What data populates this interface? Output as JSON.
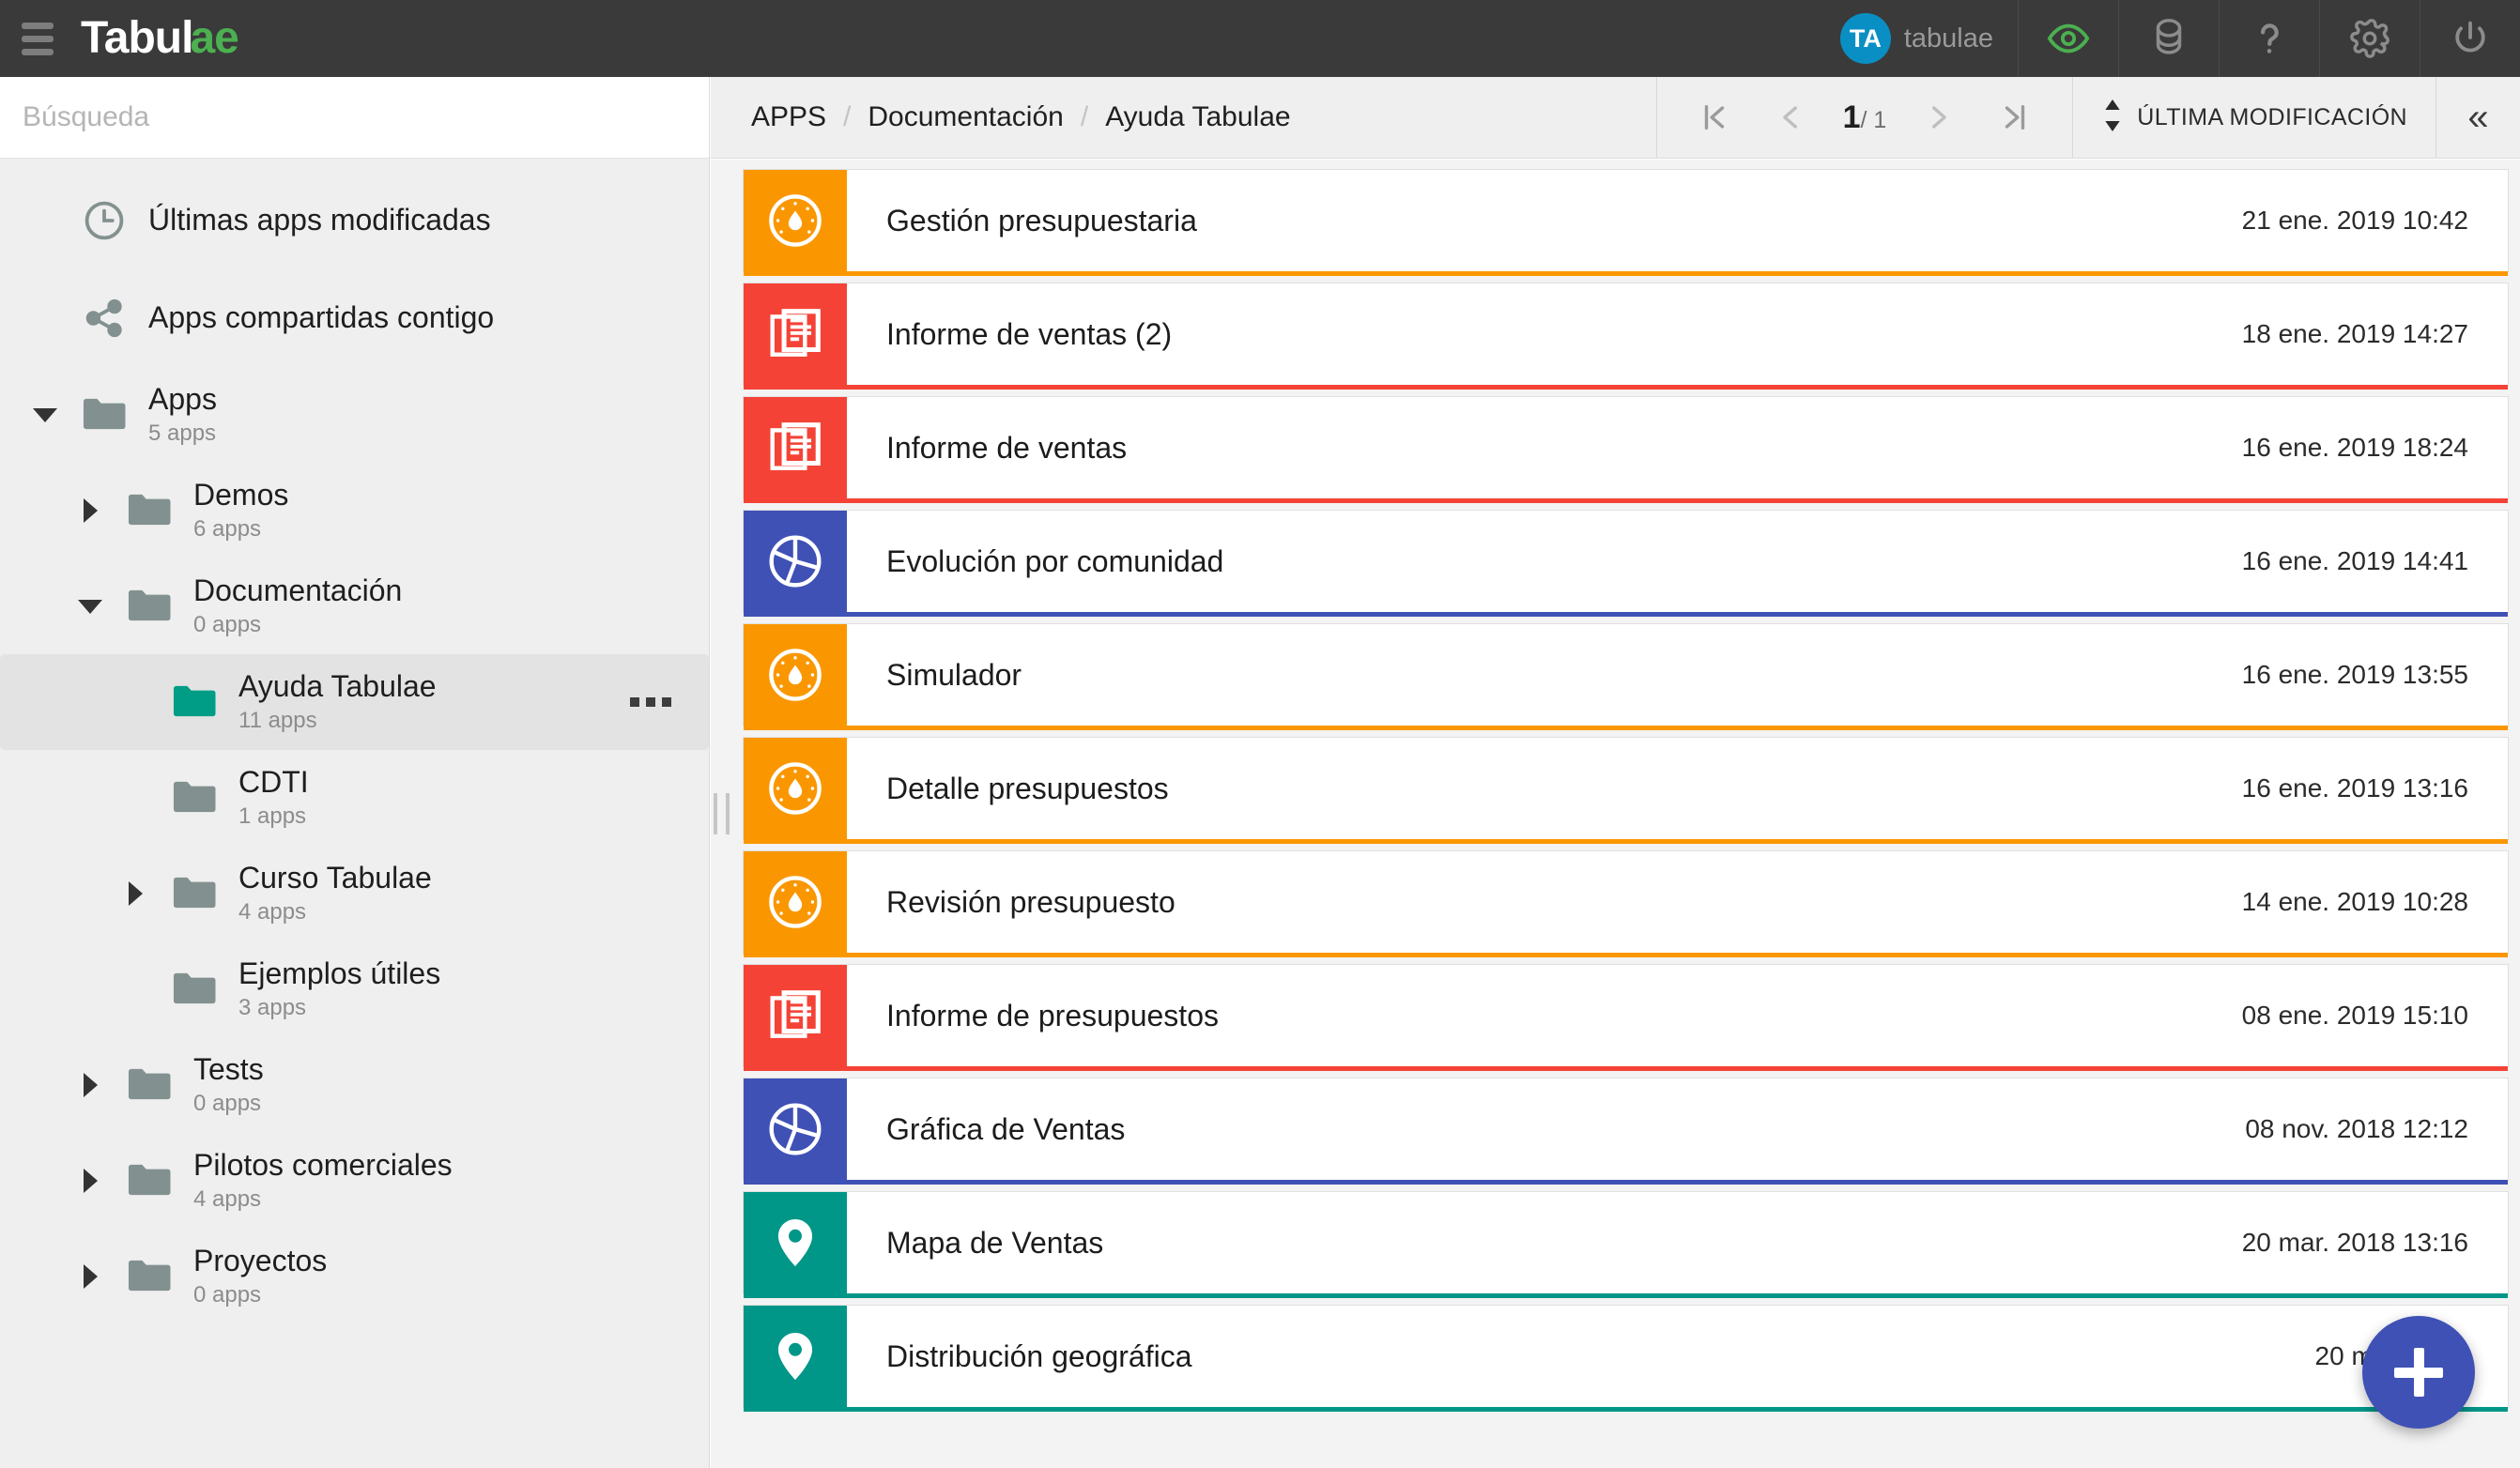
{
  "topbar": {
    "menu_icon": "hamburger-icon",
    "brand_main": "Tabul",
    "brand_accent": "ae",
    "avatar_initials": "TA",
    "username": "tabulae",
    "icons": [
      {
        "name": "eye-icon",
        "color": "#4caf50"
      },
      {
        "name": "database-icon",
        "color": "#8c8c8c"
      },
      {
        "name": "help-icon",
        "color": "#8c8c8c"
      },
      {
        "name": "gear-icon",
        "color": "#8c8c8c"
      },
      {
        "name": "power-icon",
        "color": "#8c8c8c"
      }
    ]
  },
  "sidebar": {
    "search": {
      "value": "",
      "placeholder": "Búsqueda"
    },
    "quick_links": [
      {
        "label": "Últimas apps modificadas",
        "icon": "clock-icon"
      },
      {
        "label": "Apps compartidas contigo",
        "icon": "share-icon"
      }
    ],
    "tree": [
      {
        "label": "Apps",
        "count": "5 apps",
        "level": 0,
        "expanded": true,
        "selected": false
      },
      {
        "label": "Demos",
        "count": "6 apps",
        "level": 1,
        "expanded": false,
        "selected": false
      },
      {
        "label": "Documentación",
        "count": "0 apps",
        "level": 1,
        "expanded": true,
        "selected": false
      },
      {
        "label": "Ayuda Tabulae",
        "count": "11 apps",
        "level": 2,
        "expanded": null,
        "selected": true
      },
      {
        "label": "CDTI",
        "count": "1 apps",
        "level": 2,
        "expanded": null,
        "selected": false
      },
      {
        "label": "Curso Tabulae",
        "count": "4 apps",
        "level": 2,
        "expanded": false,
        "selected": false
      },
      {
        "label": "Ejemplos útiles",
        "count": "3 apps",
        "level": 2,
        "expanded": null,
        "selected": false
      },
      {
        "label": "Tests",
        "count": "0 apps",
        "level": 1,
        "expanded": false,
        "selected": false
      },
      {
        "label": "Pilotos comerciales",
        "count": "4 apps",
        "level": 1,
        "expanded": false,
        "selected": false
      },
      {
        "label": "Proyectos",
        "count": "0 apps",
        "level": 1,
        "expanded": false,
        "selected": false
      }
    ]
  },
  "toolbar": {
    "breadcrumb": [
      "APPS",
      "Documentación",
      "Ayuda Tabulae"
    ],
    "breadcrumb_separator": "/",
    "pager": {
      "first_label": "first-page",
      "prev_label": "previous-page",
      "current": "1",
      "total": "/ 1",
      "next_label": "next-page",
      "last_label": "last-page"
    },
    "sort_label": "ÚLTIMA MODIFICACIÓN",
    "collapse_label": "«"
  },
  "colors": {
    "dashboard": "#fa9700",
    "report": "#f44336",
    "chart": "#3f51b5",
    "map": "#009688",
    "fab": "#3f51b5",
    "selected_folder": "#009d86",
    "folder": "#82918f",
    "brand_green": "#4caf50"
  },
  "apps": [
    {
      "name": "Gestión presupuestaria",
      "date": "21 ene. 2019 10:42",
      "icon": "gauge-icon",
      "color": "#fa9700"
    },
    {
      "name": "Informe de ventas (2)",
      "date": "18 ene. 2019 14:27",
      "icon": "report-icon",
      "color": "#f44336"
    },
    {
      "name": "Informe de ventas",
      "date": "16 ene. 2019 18:24",
      "icon": "report-icon",
      "color": "#f44336"
    },
    {
      "name": "Evolución por comunidad",
      "date": "16 ene. 2019 14:41",
      "icon": "pie-icon",
      "color": "#3f51b5"
    },
    {
      "name": "Simulador",
      "date": "16 ene. 2019 13:55",
      "icon": "gauge-icon",
      "color": "#fa9700"
    },
    {
      "name": "Detalle presupuestos",
      "date": "16 ene. 2019 13:16",
      "icon": "gauge-icon",
      "color": "#fa9700"
    },
    {
      "name": "Revisión presupuesto",
      "date": "14 ene. 2019 10:28",
      "icon": "gauge-icon",
      "color": "#fa9700"
    },
    {
      "name": "Informe de presupuestos",
      "date": "08 ene. 2019 15:10",
      "icon": "report-icon",
      "color": "#f44336"
    },
    {
      "name": "Gráfica de Ventas",
      "date": "08 nov. 2018 12:12",
      "icon": "pie-icon",
      "color": "#3f51b5"
    },
    {
      "name": "Mapa de Ventas",
      "date": "20 mar. 2018 13:16",
      "icon": "pin-icon",
      "color": "#009688"
    },
    {
      "name": "Distribución geográfica",
      "date": "20 mar. 2018",
      "icon": "pin-icon",
      "color": "#009688"
    }
  ],
  "fab": {
    "name": "add-app-button",
    "label": "+"
  }
}
